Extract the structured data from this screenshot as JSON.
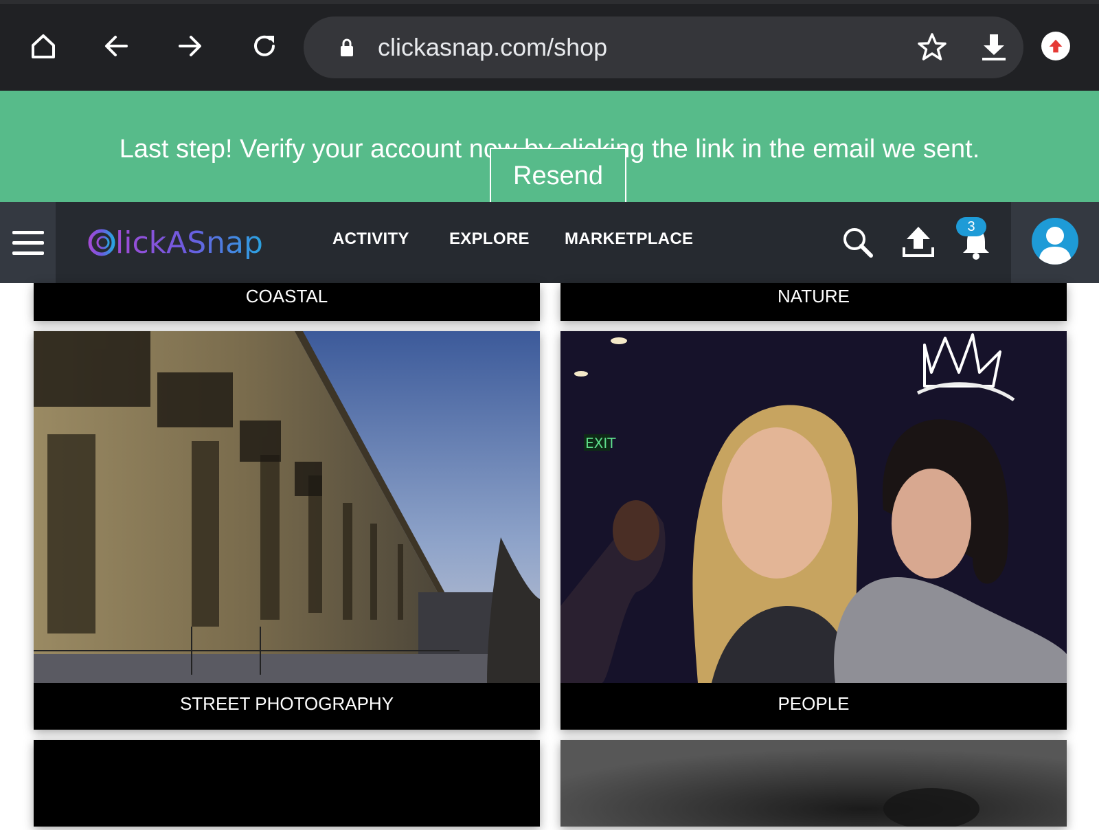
{
  "browser": {
    "url": "clickasnap.com/shop",
    "icons": [
      "home-icon",
      "back-icon",
      "forward-icon",
      "reload-icon",
      "lock-icon",
      "star-icon",
      "download-icon",
      "upload-extension-icon"
    ]
  },
  "banner": {
    "message": "Last step! Verify your account now by clicking the link in the email we sent.",
    "resend_label": "Resend",
    "color": "#57bb8a"
  },
  "nav": {
    "logo_text": "ClickASnap",
    "links": [
      "ACTIVITY",
      "EXPLORE",
      "MARKETPLACE"
    ],
    "notification_count": "3",
    "accent": "#1e9bd7",
    "icons": [
      "menu-icon",
      "search-icon",
      "upload-icon",
      "bell-icon",
      "user-icon"
    ]
  },
  "categories": [
    {
      "label": "COASTAL"
    },
    {
      "label": "NATURE"
    },
    {
      "label": "STREET PHOTOGRAPHY"
    },
    {
      "label": "PEOPLE"
    }
  ]
}
